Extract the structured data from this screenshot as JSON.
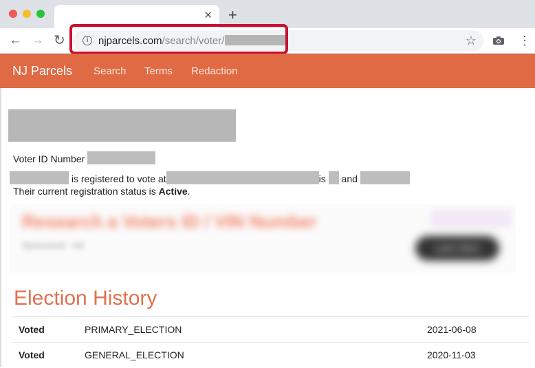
{
  "browser": {
    "address": {
      "domain": "njparcels.com",
      "path": "/search/voter/"
    }
  },
  "site": {
    "brand": "NJ Parcels",
    "nav": [
      "Search",
      "Terms",
      "Redaction"
    ]
  },
  "voter": {
    "id_label": "Voter ID Number",
    "registered_text": "is registered to vote at",
    "is_text": "is",
    "and_text": "and",
    "status_prefix": "Their current registration status is",
    "status": "Active",
    "status_suffix": "."
  },
  "ad": {
    "headline": "Research a Voters ID / VIN Number",
    "subtext": "Sponsored · Ad",
    "cta": "Learn More"
  },
  "election_history": {
    "title": "Election History",
    "rows": [
      {
        "status": "Voted",
        "type": "PRIMARY_ELECTION",
        "date": "2021-06-08"
      },
      {
        "status": "Voted",
        "type": "GENERAL_ELECTION",
        "date": "2020-11-03"
      }
    ]
  },
  "colors": {
    "brand": "#e06a44",
    "highlight": "#c8102e"
  },
  "icons": [
    "info-icon",
    "star-icon",
    "camera-icon",
    "menu-icon",
    "back-icon",
    "forward-icon",
    "reload-icon",
    "close-icon",
    "plus-icon"
  ]
}
